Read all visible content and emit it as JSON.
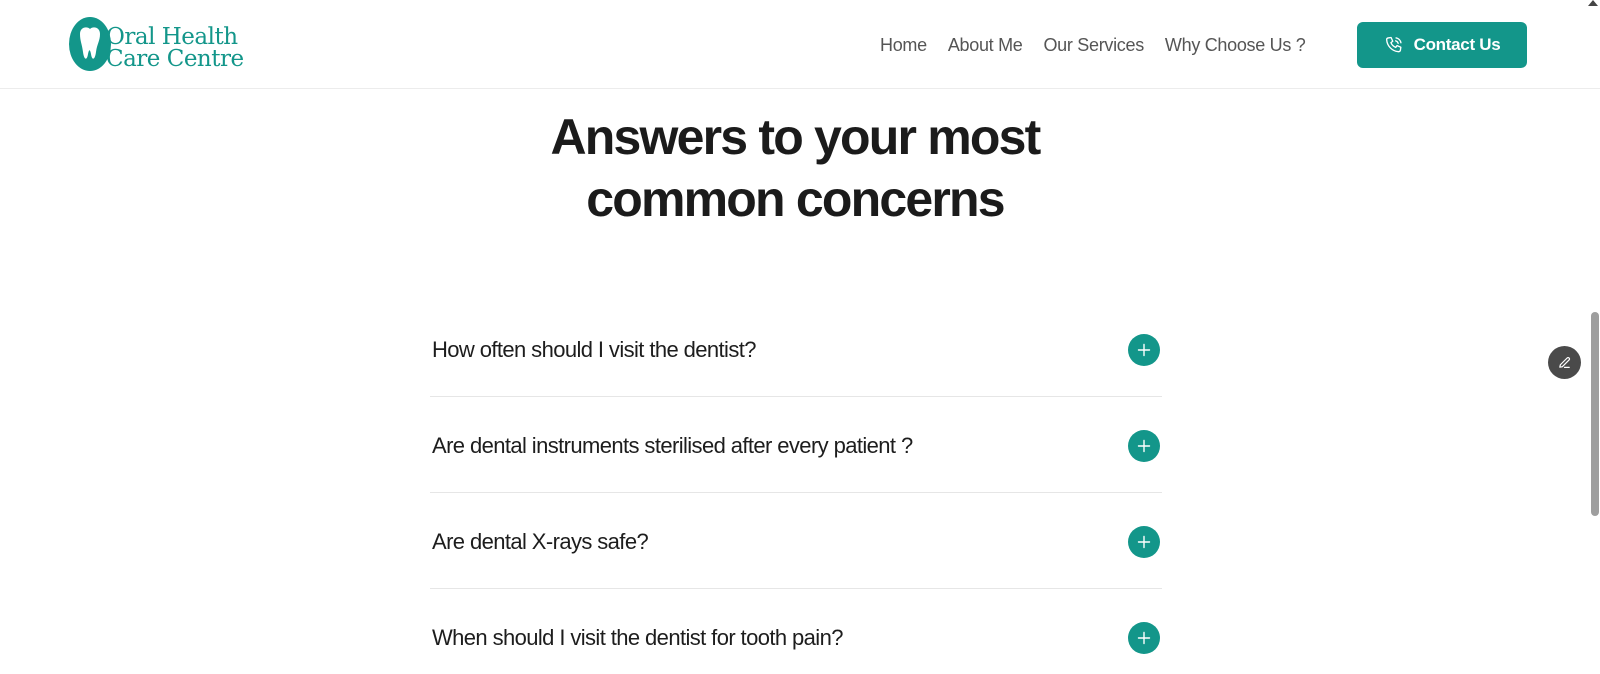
{
  "header": {
    "logo": {
      "line1": "Oral Health",
      "line2": "Care Centre",
      "icon": "tooth-icon"
    },
    "nav": [
      {
        "label": "Home"
      },
      {
        "label": "About Me"
      },
      {
        "label": "Our Services"
      },
      {
        "label": "Why Choose Us ?"
      }
    ],
    "contact_button": {
      "label": "Contact Us",
      "icon": "phone-icon"
    }
  },
  "faq_section": {
    "title_line1": "Answers to your most",
    "title_line2": "common concerns",
    "items": [
      {
        "question": "How often should I visit the dentist?",
        "toggle_icon": "plus-icon"
      },
      {
        "question": "Are dental instruments sterilised after every patient ?",
        "toggle_icon": "plus-icon"
      },
      {
        "question": "Are dental X-rays safe?",
        "toggle_icon": "plus-icon"
      },
      {
        "question": "When should I visit the dentist for tooth pain?",
        "toggle_icon": "plus-icon"
      }
    ]
  },
  "floating": {
    "edit_icon": "pencil-icon"
  },
  "colors": {
    "brand": "#13968a",
    "text": "#1b1b1b",
    "nav": "#555555",
    "fab": "#4a4a4a"
  }
}
